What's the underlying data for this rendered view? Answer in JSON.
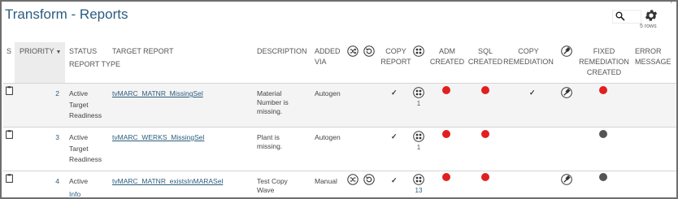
{
  "page": {
    "title": "Transform - Reports",
    "rows_label": "5 rows"
  },
  "colors": {
    "red": "#e02020",
    "dark": "#555555",
    "link": "#2a5d7e"
  },
  "columns": {
    "s": "S",
    "priority": "PRIORITY",
    "status": "STATUS",
    "report_type": "REPORT TYPE",
    "target_report": "TARGET REPORT",
    "description": "DESCRIPTION",
    "added_via": "ADDED VIA",
    "copy_report": "COPY REPORT",
    "adm_created": "ADM CREATED",
    "sql_created": "SQL CREATED",
    "copy_remediation": "COPY REMEDIATION",
    "fixed_remediation_created": "FIXED REMEDIATION CREATED",
    "error_message": "ERROR MESSAGE"
  },
  "rows": [
    {
      "priority": "2",
      "status": "Active",
      "report_type": "Target Readiness",
      "target_report": "tvMARC_MATNR_MissingSel",
      "description": "Material Number is missing.",
      "added_via": "Autogen",
      "group_count": "1",
      "adm": "red",
      "sql": "red",
      "copy_remediation": true,
      "fixed": "red"
    },
    {
      "priority": "3",
      "status": "Active",
      "report_type": "Target Readiness",
      "target_report": "tvMARC_WERKS_MissingSel",
      "description": "Plant is missing.",
      "added_via": "Autogen",
      "group_count": "1",
      "adm": "red",
      "sql": "red",
      "copy_remediation": false,
      "fixed": "dark"
    },
    {
      "priority": "4",
      "status": "Active",
      "report_type": "Info",
      "target_report": "tvMARC_MATNR_existsInMARASel",
      "description": "Test Copy Wave",
      "added_via": "Manual",
      "group_count": "13",
      "adm": "red",
      "sql": "red",
      "copy_remediation": false,
      "fixed": "dark"
    }
  ]
}
